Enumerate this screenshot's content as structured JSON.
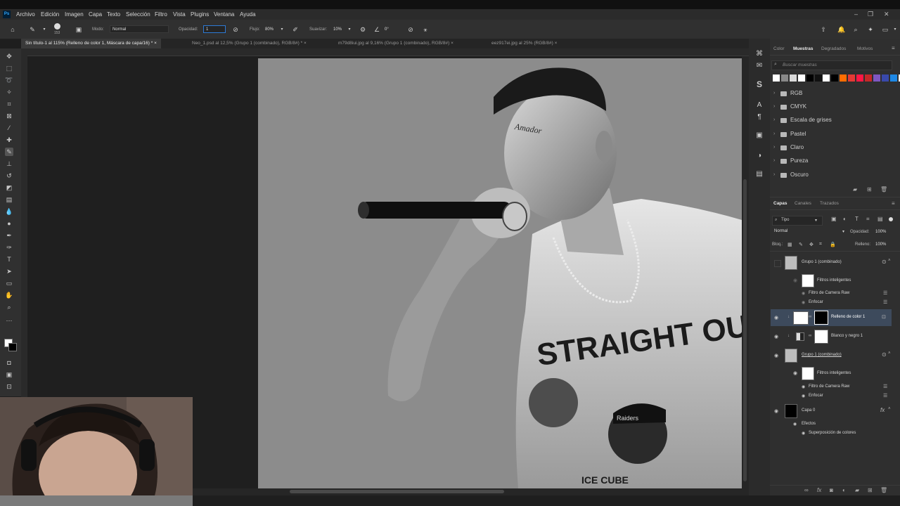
{
  "app": {
    "logo": "Ps"
  },
  "menu": [
    "Archivo",
    "Edición",
    "Imagen",
    "Capa",
    "Texto",
    "Selección",
    "Filtro",
    "Vista",
    "Plugins",
    "Ventana",
    "Ayuda"
  ],
  "options": {
    "brush_size": "153",
    "mode_label": "Modo:",
    "mode_value": "Normal",
    "opacity_label": "Opacidad:",
    "opacity_value": "1",
    "flow_label": "Flujo:",
    "flow_value": "80%",
    "smooth_label": "Suavizar:",
    "smooth_value": "10%",
    "angle_value": "0°"
  },
  "tabs": [
    "Sin título-1 al 115% (Relleno de color 1, Máscara de capa/16) *",
    "Neo_1.psd al 12,5% (Grupo 1 (combinado), RGB/8#) *",
    "m79d8iui.jpg al 9,16% (Grupo 1 (combinado), RGB/8#)",
    "eez917ei.jpg al 25% (RGB/8#)"
  ],
  "swatches_panel": {
    "tabs": [
      "Color",
      "Muestras",
      "Degradados",
      "Motivos"
    ],
    "active_tab": "Muestras",
    "search_placeholder": "Buscar muestras",
    "colors": [
      "#ffffff",
      "#888888",
      "#d9d9d9",
      "#ffffff",
      "#000000",
      "#111111",
      "#ffffff",
      "#000000",
      "#ff6d00",
      "#e53935",
      "#ff1744",
      "#c62828",
      "#7e57c2",
      "#3949ab",
      "#1e88e5",
      "#ffffff"
    ],
    "folders": [
      "RGB",
      "CMYK",
      "Escala de grises",
      "Pastel",
      "Claro",
      "Pureza",
      "Oscuro"
    ]
  },
  "layers_panel": {
    "tabs": [
      "Capas",
      "Canales",
      "Trazados"
    ],
    "active_tab": "Capas",
    "filter_label": "Tipo",
    "blend_mode": "Normal",
    "opacity_label": "Opacidad:",
    "opacity_value": "100%",
    "lock_label": "Bloq.:",
    "fill_label": "Relleno:",
    "fill_value": "100%",
    "layers": {
      "g1_top": "Grupo 1 (combinado)",
      "g1_top_smart": "Filtros inteligentes",
      "g1_top_f1": "Filtro de Camera Raw",
      "g1_top_f2": "Enfocar",
      "fill": "Relleno de color 1",
      "bw": "Blanco y negro 1",
      "g1_bot": "Grupo 1 (combinado)",
      "g1_bot_smart": "Filtros inteligentes",
      "g1_bot_f1": "Filtro de Camera Raw",
      "g1_bot_f2": "Enfocar",
      "capa0": "Capa 0",
      "effects": "Efectos",
      "overlay": "Superposición de colores"
    }
  },
  "artwork": {
    "shirt_text": "STRAIGHT OUTTA",
    "shirt_sub": "ICE CUBE",
    "cap_text": "Raiders",
    "face_text": "Amador"
  }
}
